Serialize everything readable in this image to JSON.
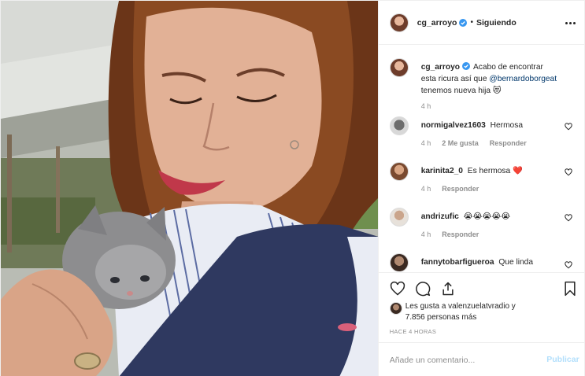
{
  "header": {
    "username": "cg_arroyo",
    "separator": "•",
    "follow_label": "Siguiendo"
  },
  "caption": {
    "username": "cg_arroyo",
    "text_before": "Acabo de encontrar esta ricura así que",
    "mention": "@bernardoborgeat",
    "text_after": "tenemos nueva hija 😻",
    "time": "4 h"
  },
  "comments": [
    {
      "username": "normigalvez1603",
      "text": "Hermosa",
      "time": "4 h",
      "likes": "2 Me gusta",
      "reply": "Responder"
    },
    {
      "username": "karinita2_0",
      "text": "Es hermosa ❤️",
      "time": "4 h",
      "reply": "Responder"
    },
    {
      "username": "andrizufic",
      "text": "😭😭😭😭😭",
      "time": "4 h",
      "reply": "Responder"
    },
    {
      "username": "fannytobarfigueroa",
      "text": "Que linda"
    }
  ],
  "likes": {
    "line1": "Les gusta a valenzuelatvradio y",
    "line2": "7.856 personas más"
  },
  "timestamp": "HACE 4 HORAS",
  "add_comment": {
    "placeholder": "Añade un comentario...",
    "publish_label": "Publicar"
  },
  "colors": {
    "verified": "#3897f0",
    "publish_disabled": "#b2dffc",
    "mention": "#00376b",
    "heart_red": "#ed4956"
  },
  "icons": [
    "verified-badge-icon",
    "more-options-icon",
    "like-heart-icon",
    "comment-icon",
    "share-icon",
    "save-bookmark-icon"
  ]
}
